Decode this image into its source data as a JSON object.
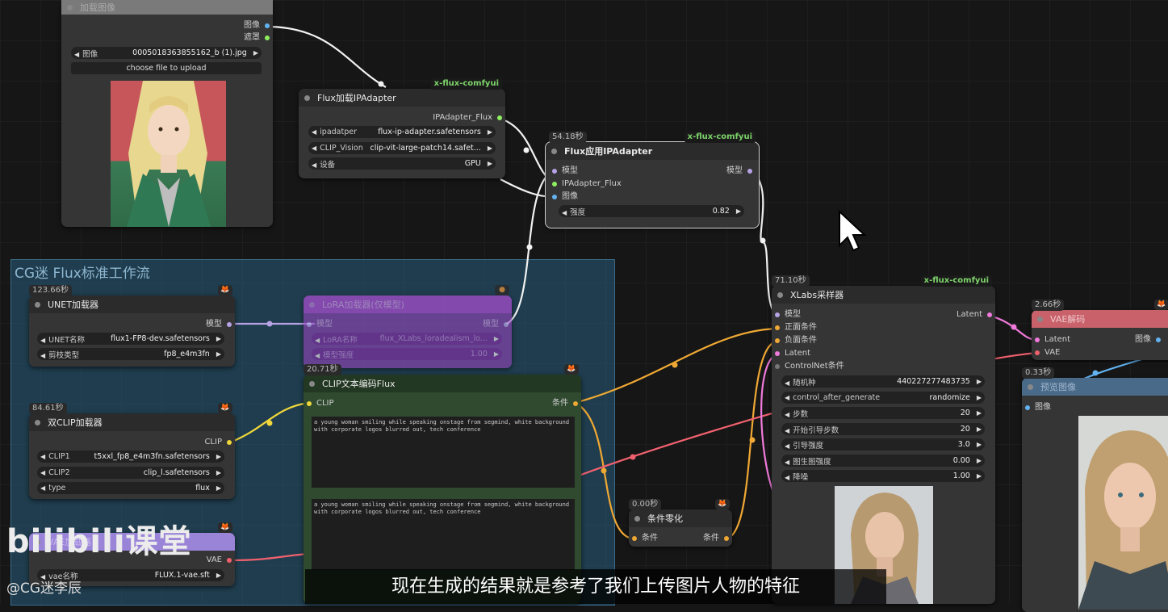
{
  "group": {
    "title": "CG迷 Flux标准工作流"
  },
  "load_image": {
    "title": "加载图像",
    "out_image": "图像",
    "out_mask": "遮罩",
    "image_label": "图像",
    "image_value": "0005018363855162_b (1).jpg",
    "upload_label": "choose file to upload"
  },
  "ip_loader": {
    "tag": "x-flux-comfyui",
    "title": "Flux加载IPAdapter",
    "out": "IPAdapter_Flux",
    "w1_label": "ipadatper",
    "w1_value": "flux-ip-adapter.safetensors",
    "w2_label": "CLIP_Vision",
    "w2_value": "clip-vit-large-patch14.safet...",
    "w3_label": "设备",
    "w3_value": "GPU"
  },
  "ip_apply": {
    "time": "54.18秒",
    "tag": "x-flux-comfyui",
    "title": "Flux应用IPAdapter",
    "in1": "模型",
    "in2": "IPAdapter_Flux",
    "in3": "图像",
    "out": "模型",
    "w_label": "强度",
    "w_value": "0.82"
  },
  "unet": {
    "time": "123.66秒",
    "title": "UNET加载器",
    "out": "模型",
    "w1_label": "UNET名称",
    "w1_value": "flux1-FP8-dev.safetensors",
    "w2_label": "剪枝类型",
    "w2_value": "fp8_e4m3fn"
  },
  "lora": {
    "title": "LoRA加载器(仅模型)",
    "in": "模型",
    "out": "模型",
    "w1_label": "LoRA名称",
    "w1_value": "flux_XLabs_loradealism_lo...",
    "w2_label": "模型强度",
    "w2_value": "1.00"
  },
  "clip_text": {
    "time": "20.71秒",
    "title": "CLIP文本编码Flux",
    "in": "CLIP",
    "out": "条件",
    "text1": "a young woman smiling while speaking onstage from segmind, white background with corporate logos blurred out, tech conference",
    "text2": "a young woman smiling while speaking onstage from segmind, white background with corporate logos blurred out, tech conference"
  },
  "dual_clip": {
    "time": "84.61秒",
    "title": "双CLIP加载器",
    "out": "CLIP",
    "w1_label": "CLIP1",
    "w1_value": "t5xxl_fp8_e4m3fn.safetensors",
    "w2_label": "CLIP2",
    "w2_value": "clip_l.safetensors",
    "w3_label": "type",
    "w3_value": "flux"
  },
  "vae_loader": {
    "title": "VAE加载器",
    "out": "VAE",
    "w_label": "vae名称",
    "w_value": "FLUX.1-vae.sft"
  },
  "cond_zero": {
    "time": "0.00秒",
    "title": "条件零化",
    "in": "条件",
    "out": "条件"
  },
  "sampler": {
    "time": "71.10秒",
    "tag": "x-flux-comfyui",
    "title": "XLabs采样器",
    "in1": "模型",
    "in2": "正面条件",
    "in3": "负面条件",
    "in4": "Latent",
    "in5": "ControlNet条件",
    "out": "Latent",
    "widgets": [
      {
        "label": "随机种",
        "value": "440227277483735"
      },
      {
        "label": "control_after_generate",
        "value": "randomize"
      },
      {
        "label": "步数",
        "value": "20"
      },
      {
        "label": "开始引导步数",
        "value": "20"
      },
      {
        "label": "引导强度",
        "value": "3.0"
      },
      {
        "label": "图生图强度",
        "value": "0.00"
      },
      {
        "label": "降噪",
        "value": "1.00"
      }
    ]
  },
  "vae_decode": {
    "time": "2.66秒",
    "title": "VAE解码",
    "in1": "Latent",
    "in2": "VAE",
    "out": "图像"
  },
  "preview": {
    "time": "0.33秒",
    "title": "预览图像",
    "in": "图像"
  },
  "watermark": {
    "logo": "bilibili课堂",
    "handle": "@CG迷李辰"
  },
  "subtitle": "现在生成的结果就是参考了我们上传图片人物的特征",
  "colors": {
    "model": "#b6a3e6",
    "clip": "#f0d73b",
    "conditioning": "#f0a834",
    "image": "#63b3f0",
    "vae": "#f0616e",
    "ipadapter": "#8ef060",
    "latent": "#f07adb"
  }
}
